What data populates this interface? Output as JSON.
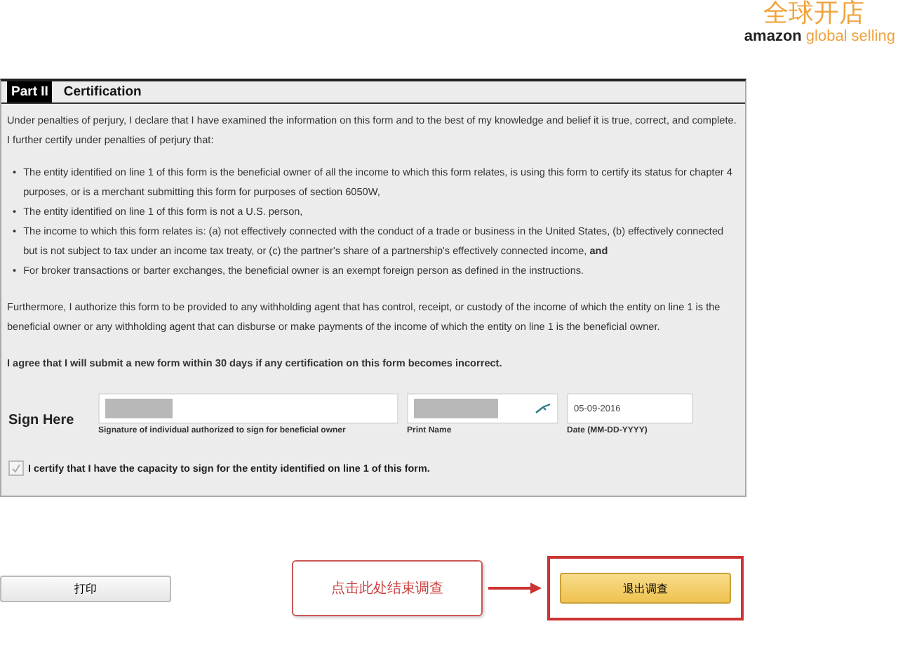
{
  "logo": {
    "title": "全球开店",
    "brand": "amazon",
    "subtitle": "global selling"
  },
  "form": {
    "part": "Part II",
    "title": "Certification",
    "intro": "Under penalties of perjury, I declare that I have examined the information on this form and to the best of my knowledge and belief it is true, correct, and complete. I further certify under penalties of perjury that:",
    "bullets": [
      {
        "marker": "•",
        "text": "The entity identified on line 1 of this form is the beneficial owner of all the income to which this form relates, is using this form to certify its status for chapter 4 purposes, or is a merchant submitting this form for purposes of section 6050W,"
      },
      {
        "marker": "•",
        "text": "The entity identified on line 1 of this form is not a U.S. person,"
      },
      {
        "marker": "•",
        "text": "The income to which this form relates is: (a) not effectively connected with the conduct of a trade or business in the United States, (b) effectively connected but is not subject to tax under an income tax treaty, or (c) the partner's share of a partnership's effectively connected income, **and**"
      },
      {
        "marker": "•",
        "text": "For broker transactions or barter exchanges, the beneficial owner is an exempt foreign person as defined in the instructions."
      }
    ],
    "authorization": "Furthermore, I authorize this form to be provided to any withholding agent that has control, receipt, or custody of the income of which the entity on line 1 is the beneficial owner or any withholding agent that can disburse or make payments of the income of which the entity on line 1 is the beneficial owner.",
    "agreement": "I agree that I will submit a new form within 30 days if any certification on this form becomes incorrect.",
    "sign_label": "Sign Here",
    "fields": [
      {
        "kind": "signature",
        "label": "Signature of individual authorized to sign for beneficial owner"
      },
      {
        "kind": "name",
        "label": "Print Name"
      },
      {
        "kind": "date",
        "label": "Date (MM-DD-YYYY)",
        "value": "05-09-2016"
      }
    ],
    "capacity": {
      "label": "I certify that I have the capacity to sign for the entity identified on line 1 of this form.",
      "checked": true
    }
  },
  "footer": {
    "print_button": "打印",
    "callout": "点击此处结束调查",
    "exit_button": "退出调查"
  }
}
